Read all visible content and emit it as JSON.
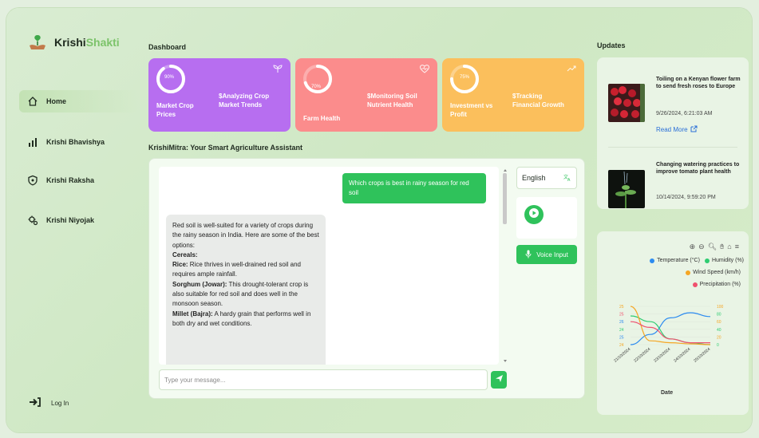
{
  "brand": {
    "name_prefix": "Krishi",
    "name_suffix": "Shakti"
  },
  "sidebar": {
    "items": [
      {
        "label": "Home",
        "icon": "home-icon",
        "active": true
      },
      {
        "label": "Krishi Bhavishya",
        "icon": "bar-chart-icon",
        "active": false
      },
      {
        "label": "Krishi Raksha",
        "icon": "shield-icon",
        "active": false
      },
      {
        "label": "Krishi Niyojak",
        "icon": "settings-gear-icon",
        "active": false
      }
    ],
    "login_label": "Log In"
  },
  "dashboard": {
    "title": "Dashboard",
    "cards": [
      {
        "percent_label": "90%",
        "progress": 0.9,
        "title_line1": "$Analyzing Crop",
        "title_line2": "Market Trends",
        "label_line1": "Market Crop",
        "label_line2": "Prices",
        "color": "#b76ef0",
        "icon": "sprout-icon"
      },
      {
        "percent_label": "70%",
        "progress": 0.7,
        "title_line1": "$Monitoring Soil",
        "title_line2": "Nutrient Health",
        "label_line1": "Farm Health",
        "label_line2": "",
        "color": "#fb8c8c",
        "icon": "heart-pulse-icon"
      },
      {
        "percent_label": "75%",
        "progress": 0.75,
        "title_line1": "$Tracking",
        "title_line2": "Financial Growth",
        "label_line1": "Investment vs",
        "label_line2": "Profit",
        "color": "#fbbf5c",
        "icon": "trend-up-icon"
      }
    ]
  },
  "assistant": {
    "title": "KrishiMitra: Your Smart Agriculture Assistant",
    "user_message": "Which crops is best in rainy season for red soil",
    "bot_intro": "Red soil is well-suited for a variety of crops during the rainy season in India. Here are some of the best options:",
    "bot_heading": "Cereals:",
    "bot_items": [
      {
        "name": "Rice:",
        "text": " Rice thrives in well-drained red soil and requires ample rainfall."
      },
      {
        "name": "Sorghum (Jowar):",
        "text": " This drought-tolerant crop is also suitable for red soil and does well in the monsoon season."
      },
      {
        "name": "Millet (Bajra):",
        "text": " A hardy grain that performs well in both dry and wet conditions."
      }
    ],
    "input_placeholder": "Type your message...",
    "language": "English",
    "voice_label": "Voice Input"
  },
  "updates": {
    "title": "Updates",
    "news": [
      {
        "headline": "Toiling on a Kenyan flower farm to send fresh roses to Europe",
        "time": "9/26/2024, 6:21:03 AM",
        "link": "Read More"
      },
      {
        "headline": "Changing watering practices to improve tomato plant health",
        "time": "10/14/2024, 9:59:20 PM"
      }
    ]
  },
  "chart_data": {
    "type": "line",
    "x": [
      "21/10/2024",
      "22/10/2024",
      "23/10/2024",
      "24/10/2024",
      "25/10/2024"
    ],
    "xlabel": "Date",
    "series": [
      {
        "name": "Temperature (°C)",
        "color": "#2d8cf0",
        "axis": "left",
        "values": [
          23.5,
          24.3,
          25.6,
          26.0,
          25.7
        ]
      },
      {
        "name": "Humidity (%)",
        "color": "#2ecc71",
        "axis": "right",
        "values": [
          75,
          60,
          15,
          5,
          0
        ]
      },
      {
        "name": "Wind Speed (km/h)",
        "color": "#f5a623",
        "axis": "right",
        "values": [
          100,
          10,
          5,
          2,
          0
        ]
      },
      {
        "name": "Precipitation (%)",
        "color": "#f0506e",
        "axis": "right",
        "values": [
          60,
          45,
          15,
          5,
          5
        ]
      }
    ],
    "left_ticks": [
      "25",
      "25",
      "26",
      "24",
      "25",
      "24"
    ],
    "right_ticks": [
      "100",
      "80",
      "60",
      "40",
      "20",
      "0"
    ],
    "toolbar_icons": [
      "zoom-in-icon",
      "zoom-out-icon",
      "magnify-icon",
      "pan-hand-icon",
      "reset-home-icon",
      "menu-icon"
    ]
  }
}
